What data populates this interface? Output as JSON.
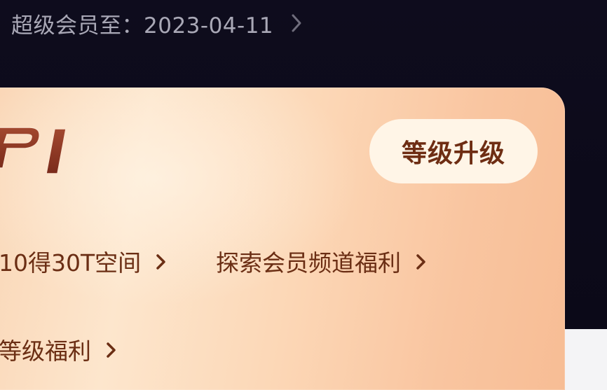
{
  "header": {
    "vip_expiry_label": "超级会员至：2023-04-11"
  },
  "card": {
    "level_badge": "P1",
    "upgrade_button_label": "等级升级",
    "links": {
      "space": "10得30T空间",
      "channel": "探索会员频道福利",
      "level": "等级福利"
    }
  },
  "colors": {
    "background_dark": "#0d0b1a",
    "card_gold": "#fde6cd",
    "accent_brown": "#6b2e14",
    "button_bg": "#fff5e7"
  }
}
